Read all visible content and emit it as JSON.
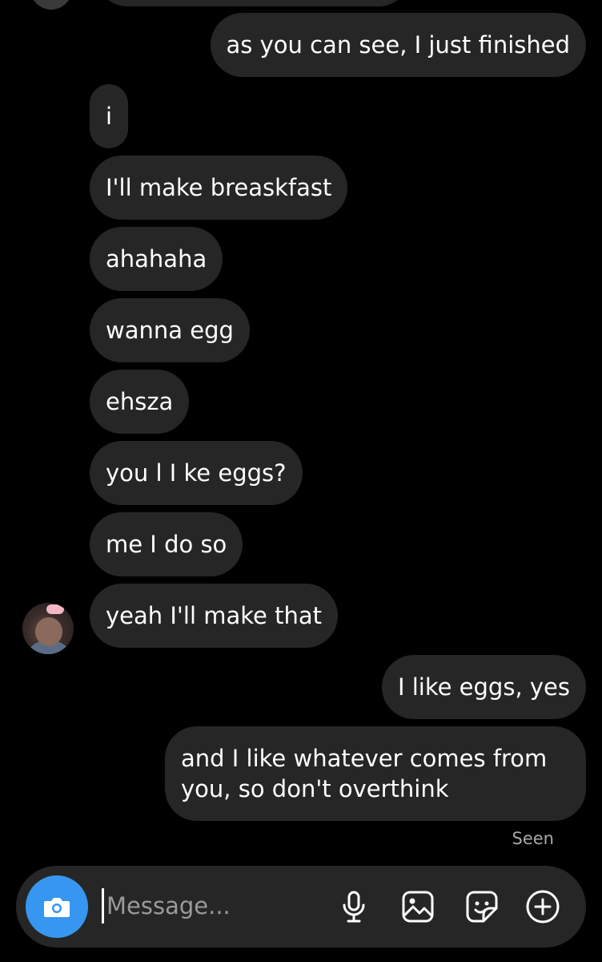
{
  "messages": {
    "m1": "as you can see, I just finished",
    "m2": "i",
    "m3": "I'll make breaskfast",
    "m4": "ahahaha",
    "m5": "wanna egg",
    "m6": "ehsza",
    "m7": "you l I ke eggs?",
    "m8": "me I do so",
    "m9": "yeah I'll make that",
    "m10": "I like eggs, yes",
    "m11": "and I like whatever comes from you, so don't overthink"
  },
  "status": {
    "seen": "Seen"
  },
  "composer": {
    "placeholder": "Message...",
    "icons": [
      "camera-icon",
      "microphone-icon",
      "gallery-icon",
      "sticker-icon",
      "plus-circle-icon"
    ]
  },
  "colors": {
    "background": "#000000",
    "bubble": "#262626",
    "accent": "#3797f0",
    "muted": "#a8a8a8"
  }
}
